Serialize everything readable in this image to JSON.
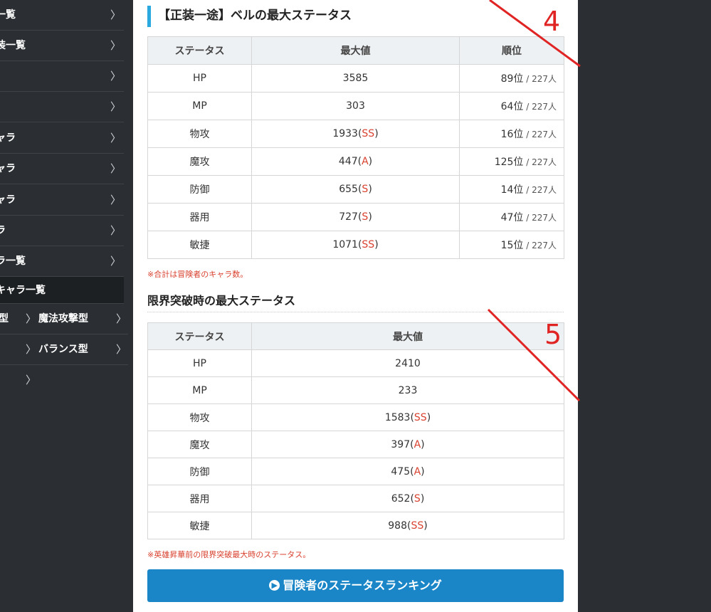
{
  "sidebar": {
    "items": [
      {
        "label": "一覧"
      },
      {
        "label": "装一覧"
      },
      {
        "label": ""
      },
      {
        "label": ""
      },
      {
        "label": "ャラ"
      },
      {
        "label": "ャラ"
      },
      {
        "label": "ャラ"
      },
      {
        "label": "ラ"
      },
      {
        "label": "ラ一覧"
      },
      {
        "label": "キャラ一覧"
      }
    ],
    "sub_items": [
      {
        "lead": "型",
        "label": "魔法攻撃型"
      },
      {
        "lead": "",
        "label": "バランス型"
      },
      {
        "lead": "",
        "label": ""
      }
    ]
  },
  "section1": {
    "title": "【正装一途】ベルの最大ステータス",
    "headers": [
      "ステータス",
      "最大値",
      "順位"
    ],
    "rows": [
      {
        "stat": "HP",
        "value": "3585",
        "grade": "",
        "rank": "89位",
        "total": " / 227人"
      },
      {
        "stat": "MP",
        "value": "303",
        "grade": "",
        "rank": "64位",
        "total": " / 227人"
      },
      {
        "stat": "物攻",
        "value": "1933",
        "grade": "SS",
        "rank": "16位",
        "total": " / 227人"
      },
      {
        "stat": "魔攻",
        "value": "447",
        "grade": "A",
        "rank": "125位",
        "total": " / 227人"
      },
      {
        "stat": "防御",
        "value": "655",
        "grade": "S",
        "rank": "14位",
        "total": " / 227人"
      },
      {
        "stat": "器用",
        "value": "727",
        "grade": "S",
        "rank": "47位",
        "total": " / 227人"
      },
      {
        "stat": "敏捷",
        "value": "1071",
        "grade": "SS",
        "rank": "15位",
        "total": " / 227人"
      }
    ],
    "note": "※合計は冒険者のキャラ数。"
  },
  "section2": {
    "title": "限界突破時の最大ステータス",
    "headers": [
      "ステータス",
      "最大値"
    ],
    "rows": [
      {
        "stat": "HP",
        "value": "2410",
        "grade": ""
      },
      {
        "stat": "MP",
        "value": "233",
        "grade": ""
      },
      {
        "stat": "物攻",
        "value": "1583",
        "grade": "SS"
      },
      {
        "stat": "魔攻",
        "value": "397",
        "grade": "A"
      },
      {
        "stat": "防御",
        "value": "475",
        "grade": "A"
      },
      {
        "stat": "器用",
        "value": "652",
        "grade": "S"
      },
      {
        "stat": "敏捷",
        "value": "988",
        "grade": "SS"
      }
    ],
    "note": "※英雄昇華前の限界突破最大時のステータス。"
  },
  "ranking_button": {
    "label": "冒険者のステータスランキング",
    "icon": "chevron-right-circle-icon"
  },
  "annotations": [
    {
      "label": "4"
    },
    {
      "label": "5"
    }
  ],
  "colors": {
    "accent": "#29a9df",
    "button": "#1a86c7",
    "grade": "#d9412f",
    "sidebar": "#2b2f33"
  }
}
